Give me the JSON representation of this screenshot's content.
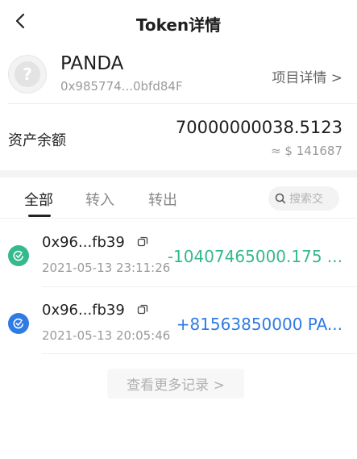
{
  "header": {
    "title": "Token详情",
    "back_icon": "chevron-left-icon"
  },
  "token": {
    "name": "PANDA",
    "address": "0x985774...0bfd84F",
    "detail_link": "项目详情 >",
    "avatar_glyph": "?"
  },
  "balance": {
    "label": "资产余额",
    "value": "70000000038.5123",
    "fiat": "≈ $ 141687"
  },
  "tabs": [
    {
      "label": "全部",
      "active": true
    },
    {
      "label": "转入",
      "active": false
    },
    {
      "label": "转出",
      "active": false
    }
  ],
  "search": {
    "placeholder": "搜索交"
  },
  "transactions": [
    {
      "hash": "0x96...fb39",
      "time": "2021-05-13 23:11:26",
      "amount": "-10407465000.175 ...",
      "status_icon": "outgoing-check-icon",
      "color": "#36b98c"
    },
    {
      "hash": "0x96...fb39",
      "time": "2021-05-13 20:05:46",
      "amount": "+81563850000 PA...",
      "status_icon": "incoming-check-icon",
      "color": "#2f7be5"
    }
  ],
  "more_button": {
    "label": "查看更多记录 >"
  }
}
